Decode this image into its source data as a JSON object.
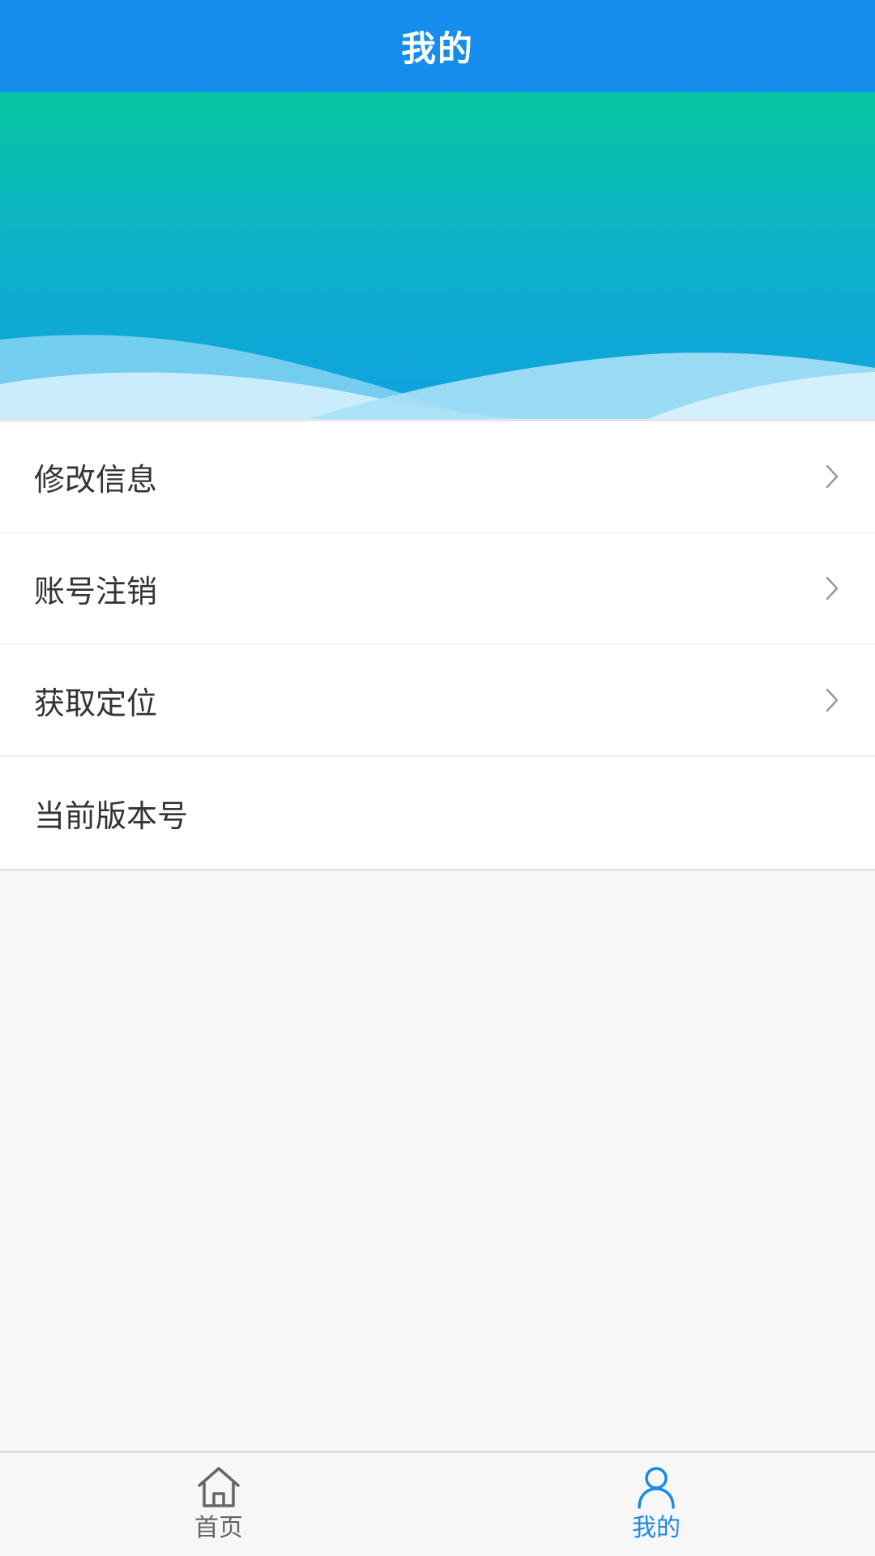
{
  "header": {
    "title": "我的"
  },
  "menu": {
    "items": [
      {
        "label": "修改信息",
        "has_arrow": true
      },
      {
        "label": "账号注销",
        "has_arrow": true
      },
      {
        "label": "获取定位",
        "has_arrow": true
      },
      {
        "label": "当前版本号",
        "has_arrow": false
      }
    ]
  },
  "tabbar": {
    "tabs": [
      {
        "label": "首页",
        "icon": "home-icon",
        "active": false
      },
      {
        "label": "我的",
        "icon": "user-icon",
        "active": true
      }
    ]
  },
  "colors": {
    "header_bg": "#148ded",
    "active_tab": "#1a8ae8",
    "inactive_tab": "#666666",
    "banner_top": "#06c6a0",
    "banner_bottom": "#10a2e0"
  }
}
